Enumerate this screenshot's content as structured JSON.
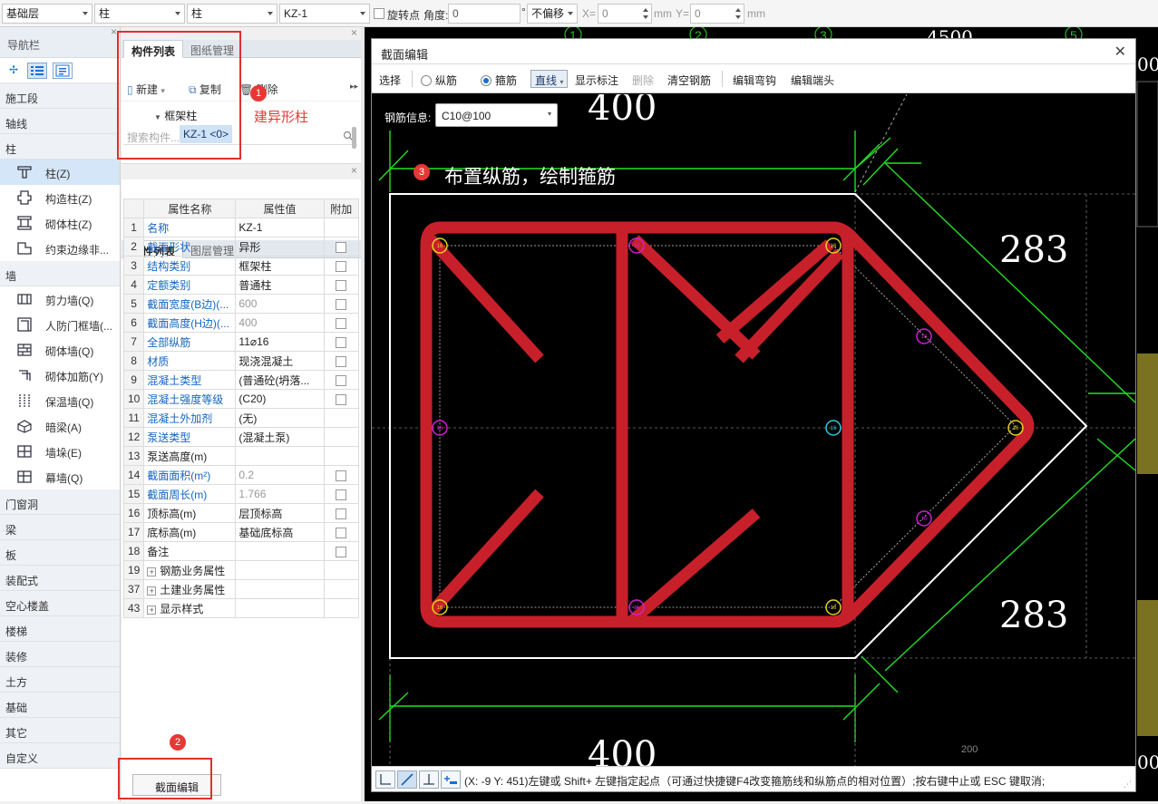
{
  "toolbar": {
    "floor": "基础层",
    "category": "柱",
    "subtype": "柱",
    "component": "KZ-1",
    "rotate_label": "旋转点",
    "angle_label": "角度:",
    "angle_value": "0",
    "deg_unit": "°",
    "offset": "不偏移",
    "x_label": "X=",
    "x_value": "0",
    "mm1": "mm",
    "y_label": "Y=",
    "y_value": "0",
    "mm2": "mm"
  },
  "nav": {
    "header": "导航栏",
    "categories_top": [
      "施工段",
      "轴线",
      "柱"
    ],
    "column_items": [
      {
        "label": "柱(Z)",
        "icon": "column-icon",
        "selected": true
      },
      {
        "label": "构造柱(Z)",
        "icon": "constructional-column-icon",
        "selected": false
      },
      {
        "label": "砌体柱(Z)",
        "icon": "masonry-column-icon",
        "selected": false
      },
      {
        "label": "约束边缘非...",
        "icon": "edge-member-icon",
        "selected": false
      }
    ],
    "wall_category": "墙",
    "wall_items": [
      {
        "label": "剪力墙(Q)",
        "icon": "shear-wall-icon"
      },
      {
        "label": "人防门框墙(...",
        "icon": "civil-defense-wall-icon"
      },
      {
        "label": "砌体墙(Q)",
        "icon": "masonry-wall-icon"
      },
      {
        "label": "砌体加筋(Y)",
        "icon": "masonry-rebar-icon"
      },
      {
        "label": "保温墙(Q)",
        "icon": "insulation-wall-icon"
      },
      {
        "label": "暗梁(A)",
        "icon": "hidden-beam-icon"
      },
      {
        "label": "墙垛(E)",
        "icon": "wall-pier-icon"
      },
      {
        "label": "幕墙(Q)",
        "icon": "curtain-wall-icon"
      }
    ],
    "categories_bottom": [
      "门窗洞",
      "梁",
      "板",
      "装配式",
      "空心楼盖",
      "楼梯",
      "装修",
      "土方",
      "基础",
      "其它",
      "自定义"
    ]
  },
  "components": {
    "tab_active": "构件列表",
    "tab_other": "图纸管理",
    "new_label": "新建",
    "copy_label": "复制",
    "delete_label": "删除",
    "search_placeholder": "搜索构件...",
    "tree_group": "框架柱",
    "tree_item": "KZ-1 <0>"
  },
  "properties": {
    "tab_active": "属性列表",
    "tab_other": "图层管理",
    "col_name": "属性名称",
    "col_value": "属性值",
    "col_extra": "附加",
    "rows": [
      {
        "n": "1",
        "name": "名称",
        "value": "KZ-1",
        "blue": true,
        "gray": false,
        "cb": false,
        "expand": false
      },
      {
        "n": "2",
        "name": "截面形状",
        "value": "异形",
        "blue": true,
        "gray": false,
        "cb": true,
        "expand": false
      },
      {
        "n": "3",
        "name": "结构类别",
        "value": "框架柱",
        "blue": true,
        "gray": false,
        "cb": true,
        "expand": false
      },
      {
        "n": "4",
        "name": "定额类别",
        "value": "普通柱",
        "blue": true,
        "gray": false,
        "cb": true,
        "expand": false
      },
      {
        "n": "5",
        "name": "截面宽度(B边)(...",
        "value": "600",
        "blue": true,
        "gray": true,
        "cb": true,
        "expand": false
      },
      {
        "n": "6",
        "name": "截面高度(H边)(...",
        "value": "400",
        "blue": true,
        "gray": true,
        "cb": true,
        "expand": false
      },
      {
        "n": "7",
        "name": "全部纵筋",
        "value": "11⌀16",
        "blue": true,
        "gray": false,
        "cb": true,
        "expand": false
      },
      {
        "n": "8",
        "name": "材质",
        "value": "现浇混凝土",
        "blue": true,
        "gray": false,
        "cb": true,
        "expand": false
      },
      {
        "n": "9",
        "name": "混凝土类型",
        "value": "(普通砼(坍落...",
        "blue": true,
        "gray": false,
        "cb": true,
        "expand": false
      },
      {
        "n": "10",
        "name": "混凝土强度等级",
        "value": "(C20)",
        "blue": true,
        "gray": false,
        "cb": true,
        "expand": false
      },
      {
        "n": "11",
        "name": "混凝土外加剂",
        "value": "(无)",
        "blue": true,
        "gray": false,
        "cb": false,
        "expand": false
      },
      {
        "n": "12",
        "name": "泵送类型",
        "value": "(混凝土泵)",
        "blue": true,
        "gray": false,
        "cb": false,
        "expand": false
      },
      {
        "n": "13",
        "name": "泵送高度(m)",
        "value": "",
        "blue": false,
        "gray": false,
        "cb": false,
        "expand": false
      },
      {
        "n": "14",
        "name": "截面面积(m²)",
        "value": "0.2",
        "blue": true,
        "gray": true,
        "cb": true,
        "expand": false
      },
      {
        "n": "15",
        "name": "截面周长(m)",
        "value": "1.766",
        "blue": true,
        "gray": true,
        "cb": true,
        "expand": false
      },
      {
        "n": "16",
        "name": "顶标高(m)",
        "value": "层顶标高",
        "blue": false,
        "gray": false,
        "cb": true,
        "expand": false
      },
      {
        "n": "17",
        "name": "底标高(m)",
        "value": "基础底标高",
        "blue": false,
        "gray": false,
        "cb": true,
        "expand": false
      },
      {
        "n": "18",
        "name": "备注",
        "value": "",
        "blue": false,
        "gray": false,
        "cb": true,
        "expand": false
      },
      {
        "n": "19",
        "name": "钢筋业务属性",
        "value": "",
        "blue": false,
        "gray": false,
        "cb": false,
        "expand": true
      },
      {
        "n": "37",
        "name": "土建业务属性",
        "value": "",
        "blue": false,
        "gray": false,
        "cb": false,
        "expand": true
      },
      {
        "n": "43",
        "name": "显示样式",
        "value": "",
        "blue": false,
        "gray": false,
        "cb": false,
        "expand": true
      }
    ]
  },
  "section_edit_button": "截面编辑",
  "annotations": {
    "step1_num": "1",
    "step1_text": "建异形柱",
    "step2_num": "2",
    "step3_num": "3",
    "step3_text": "布置纵筋，绘制箍筋"
  },
  "dialog": {
    "title": "截面编辑",
    "select": "选择",
    "long_rebar": "纵筋",
    "stirrup": "箍筋",
    "line_mode": "直线",
    "show_dims": "显示标注",
    "delete": "删除",
    "clear_rebar": "清空钢筋",
    "edit_hook": "编辑弯钩",
    "edit_end": "编辑端头",
    "rebar_info_label": "钢筋信息:",
    "rebar_info_value": "C10@100",
    "status_text": "(X: -9 Y: 451)左键或 Shift+ 左键指定起点（可通过快捷键F4改变箍筋线和纵筋点的相对位置）;按右键中止或 ESC 键取消;"
  },
  "drawing": {
    "dim_top": "400",
    "dim_bottom": "400",
    "dim_right_top": "283",
    "dim_right_bottom": "283",
    "dim_small": "200",
    "rebar_label": "16",
    "bg_dim_top": "4500",
    "bg_axis": [
      "1",
      "2",
      "3",
      "5"
    ],
    "bg_right_digit": "00",
    "colors": {
      "stirrup": "#c8202a",
      "outline": "#ffffff",
      "dims": "#22e022",
      "corner_bar": "#e8d020",
      "mid_bar": "#d020d0",
      "center_bar": "#30c8e0"
    }
  }
}
